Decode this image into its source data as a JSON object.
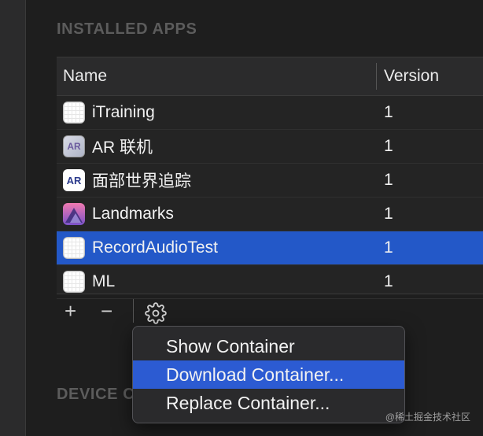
{
  "section_title": "INSTALLED APPS",
  "table": {
    "columns": [
      "Name",
      "Version"
    ],
    "rows": [
      {
        "name": "iTraining",
        "version": "1",
        "icon": "grid-app-icon",
        "selected": false
      },
      {
        "name": "AR 联机",
        "version": "1",
        "icon": "ar-link-app-icon",
        "selected": false
      },
      {
        "name": "面部世界追踪",
        "version": "1",
        "icon": "ar-face-app-icon",
        "selected": false
      },
      {
        "name": "Landmarks",
        "version": "1",
        "icon": "landmarks-app-icon",
        "selected": false
      },
      {
        "name": "RecordAudioTest",
        "version": "1",
        "icon": "grid-app-icon",
        "selected": true
      },
      {
        "name": "ML",
        "version": "1",
        "icon": "grid-app-icon",
        "selected": false
      }
    ]
  },
  "icon_text": {
    "arlink": "AR",
    "arface": "AR"
  },
  "toolbar": {
    "add_label": "+",
    "remove_label": "−",
    "gear_icon": "gear-icon"
  },
  "context_menu": {
    "items": [
      "Show Container",
      "Download Container...",
      "Replace Container..."
    ],
    "highlighted_index": 1
  },
  "device_title_partial": "DEVICE C",
  "watermark": "@稀土掘金技术社区",
  "colors": {
    "selection": "#2358c8",
    "menu_highlight": "#2c5bd2"
  }
}
